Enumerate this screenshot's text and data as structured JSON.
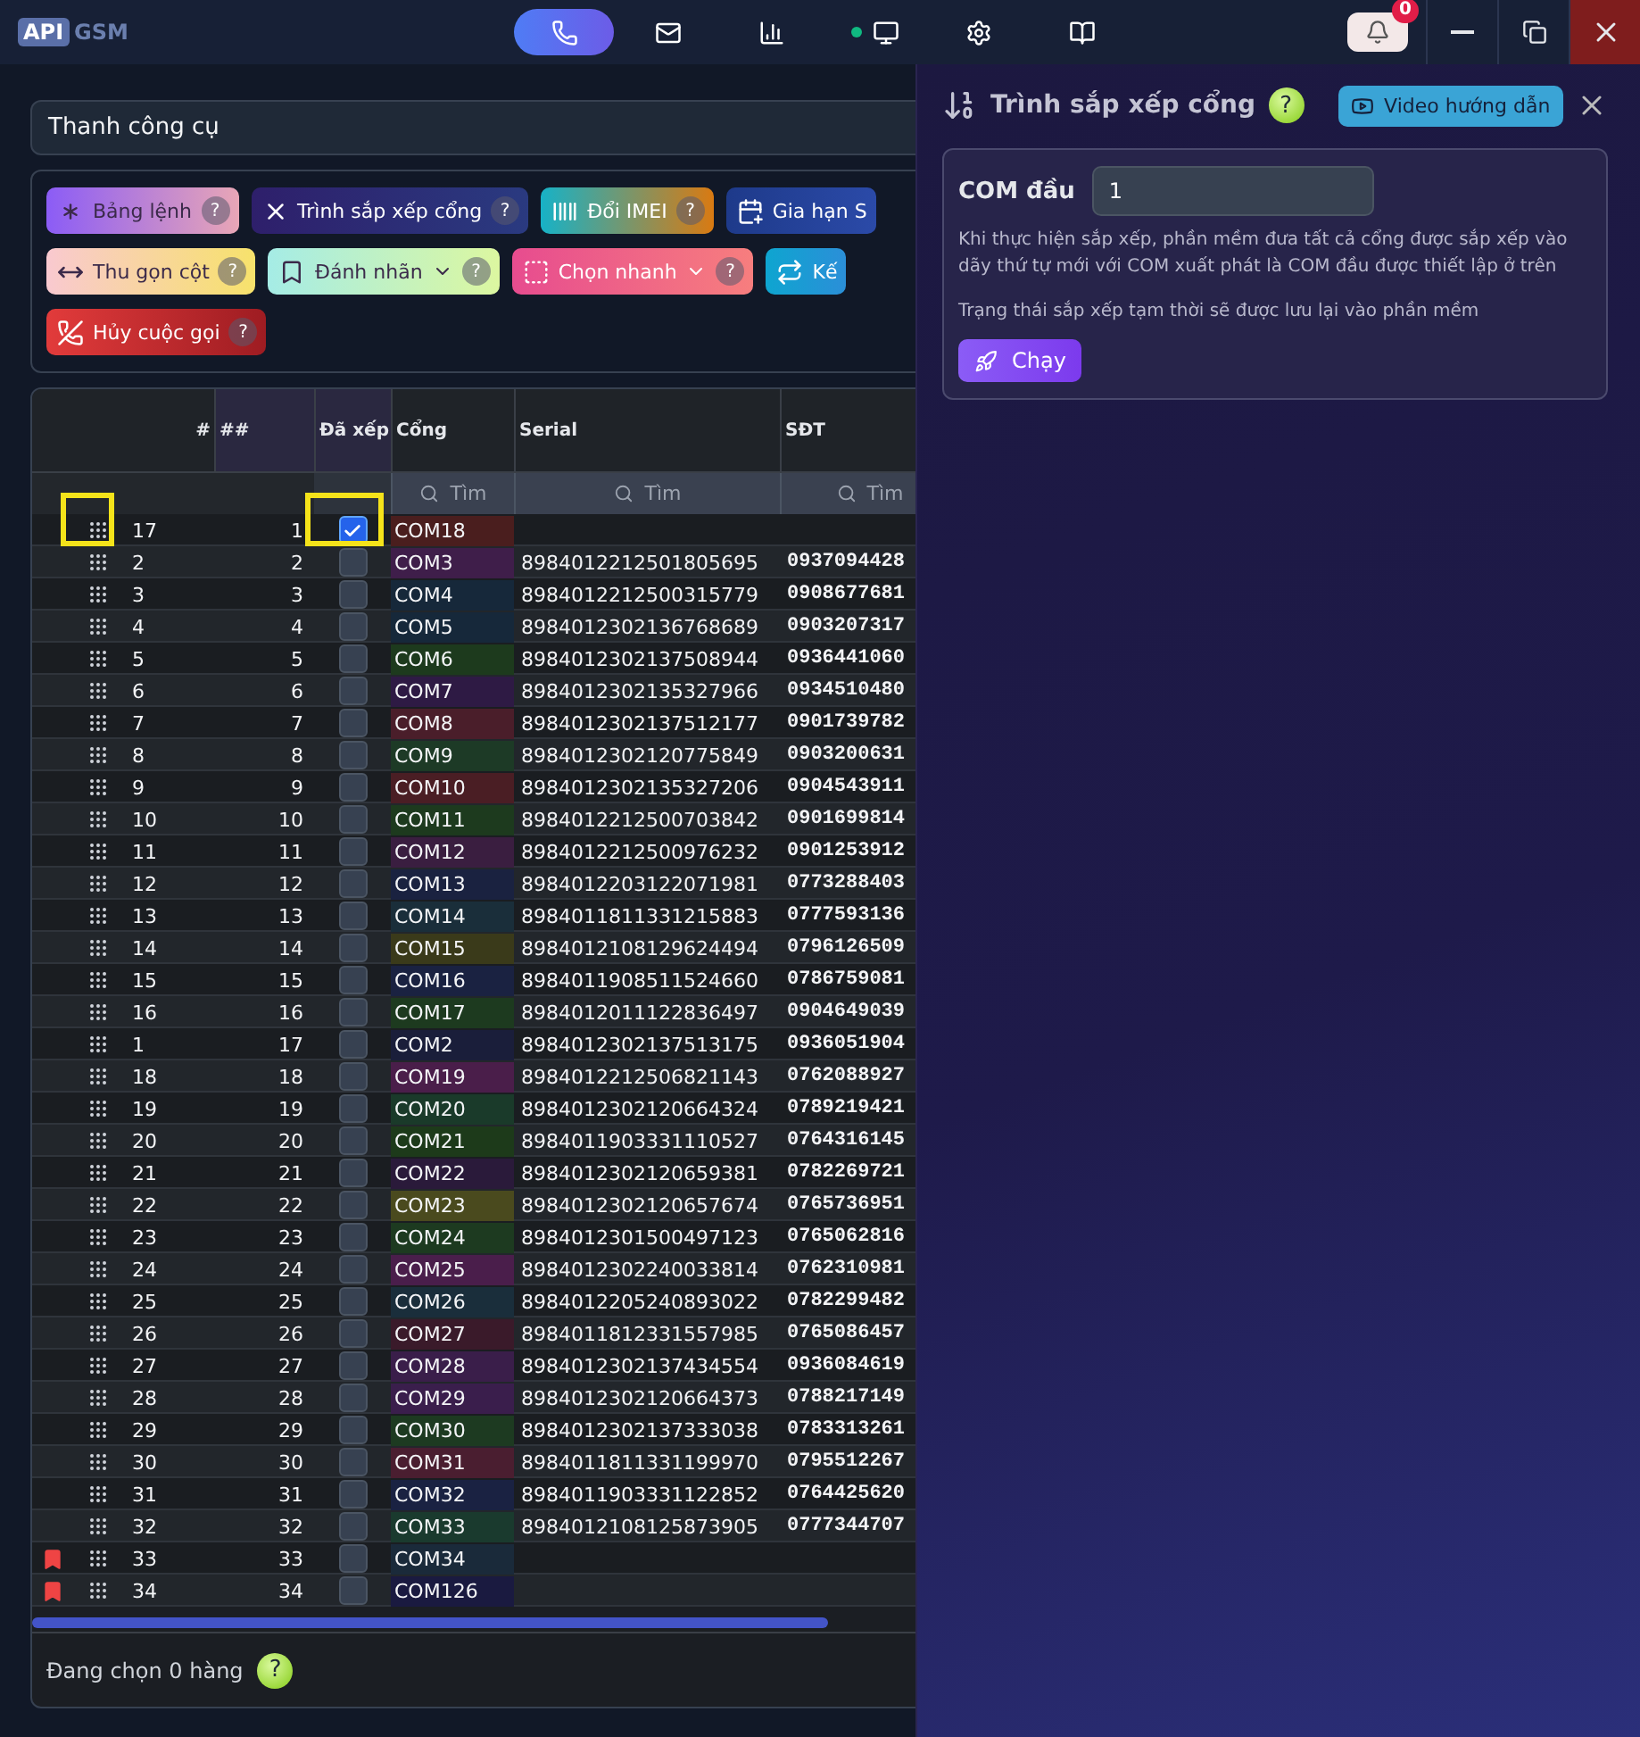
{
  "title_bar": {
    "logo": {
      "badge": "API",
      "text": "GSM"
    },
    "nav": [
      {
        "selected": true,
        "status_dot": false
      },
      {
        "selected": false,
        "status_dot": false
      },
      {
        "selected": false,
        "status_dot": false
      },
      {
        "selected": false,
        "status_dot": true
      },
      {
        "selected": false,
        "status_dot": false
      },
      {
        "selected": false,
        "status_dot": false
      }
    ],
    "notifications": {
      "count": "0"
    }
  },
  "toolbar": {
    "title": "Thanh công cụ",
    "rows": [
      [
        {
          "label": "Bảng lệnh",
          "menu": false,
          "help": "?"
        },
        {
          "label": "Trình sắp xếp cổng",
          "menu": false,
          "help": "?"
        },
        {
          "label": "Đổi IMEI",
          "menu": false,
          "help": "?"
        },
        {
          "label": "Gia hạn S",
          "menu": false
        }
      ],
      [
        {
          "label": "Thu gọn cột",
          "menu": false,
          "help": "?"
        },
        {
          "label": "Đánh nhãn",
          "menu": true,
          "help": "?"
        },
        {
          "label": "Chọn nhanh",
          "menu": true,
          "help": "?"
        },
        {
          "label": "Kế",
          "menu": false
        }
      ],
      [
        {
          "label": "Hủy cuộc gọi",
          "menu": false,
          "help": "?"
        }
      ]
    ]
  },
  "table": {
    "columns": [
      {
        "label": "#",
        "highlighted": false
      },
      {
        "label": "##",
        "highlighted": true
      },
      {
        "label": "Đã xếp",
        "highlighted": true
      },
      {
        "label": "Cổng",
        "highlighted": false
      },
      {
        "label": "Serial",
        "highlighted": false
      },
      {
        "label": "SĐT",
        "highlighted": false
      }
    ],
    "filters": [
      {
        "placeholder": "Tìm"
      },
      {
        "placeholder": "Tìm"
      },
      {
        "placeholder": "Tìm"
      }
    ],
    "rows": [
      {
        "index": "17",
        "order": "1",
        "checked": true,
        "highlighted": true,
        "flagged": false,
        "port": "COM18",
        "color": "#4a1e1e"
      },
      {
        "index": "2",
        "order": "2",
        "checked": false,
        "highlighted": false,
        "flagged": false,
        "port": "COM3",
        "color": "#3f1e4a",
        "serial": "8984012212501805695",
        "phone": "0937094428"
      },
      {
        "index": "3",
        "order": "3",
        "checked": false,
        "highlighted": false,
        "flagged": false,
        "port": "COM4",
        "color": "#16283a",
        "serial": "8984012212500315779",
        "phone": "0908677681"
      },
      {
        "index": "4",
        "order": "4",
        "checked": false,
        "highlighted": false,
        "flagged": false,
        "port": "COM5",
        "color": "#16283a",
        "serial": "8984012302136768689",
        "phone": "0903207317"
      },
      {
        "index": "5",
        "order": "5",
        "checked": false,
        "highlighted": false,
        "flagged": false,
        "port": "COM6",
        "color": "#1d3a1d",
        "serial": "8984012302137508944",
        "phone": "0936441060"
      },
      {
        "index": "6",
        "order": "6",
        "checked": false,
        "highlighted": false,
        "flagged": false,
        "port": "COM7",
        "color": "#2e1a44",
        "serial": "8984012302135327966",
        "phone": "0934510480"
      },
      {
        "index": "7",
        "order": "7",
        "checked": false,
        "highlighted": false,
        "flagged": false,
        "port": "COM8",
        "color": "#4a1e2a",
        "serial": "8984012302137512177",
        "phone": "0901739782"
      },
      {
        "index": "8",
        "order": "8",
        "checked": false,
        "highlighted": false,
        "flagged": false,
        "port": "COM9",
        "color": "#1d3a26",
        "serial": "8984012302120775849",
        "phone": "0903200631"
      },
      {
        "index": "9",
        "order": "9",
        "checked": false,
        "highlighted": false,
        "flagged": false,
        "port": "COM10",
        "color": "#4a1e24",
        "serial": "8984012302135327206",
        "phone": "0904543911"
      },
      {
        "index": "10",
        "order": "10",
        "checked": false,
        "highlighted": false,
        "flagged": false,
        "port": "COM11",
        "color": "#1d3a1e",
        "serial": "8984012212500703842",
        "phone": "0901699814"
      },
      {
        "index": "11",
        "order": "11",
        "checked": false,
        "highlighted": false,
        "flagged": false,
        "port": "COM12",
        "color": "#3a1e40",
        "serial": "8984012212500976232",
        "phone": "0901253912"
      },
      {
        "index": "12",
        "order": "12",
        "checked": false,
        "highlighted": false,
        "flagged": false,
        "port": "COM13",
        "color": "#1a2240",
        "serial": "8984012203122071981",
        "phone": "0773288403"
      },
      {
        "index": "13",
        "order": "13",
        "checked": false,
        "highlighted": false,
        "flagged": false,
        "port": "COM14",
        "color": "#1a2e3a",
        "serial": "8984011811331215883",
        "phone": "0777593136"
      },
      {
        "index": "14",
        "order": "14",
        "checked": false,
        "highlighted": false,
        "flagged": false,
        "port": "COM15",
        "color": "#3a3a1a",
        "serial": "8984012108129624494",
        "phone": "0796126509"
      },
      {
        "index": "15",
        "order": "15",
        "checked": false,
        "highlighted": false,
        "flagged": false,
        "port": "COM16",
        "color": "#1a2241",
        "serial": "8984011908511524660",
        "phone": "0786759081"
      },
      {
        "index": "16",
        "order": "16",
        "checked": false,
        "highlighted": false,
        "flagged": false,
        "port": "COM17",
        "color": "#1d3a1f",
        "serial": "8984012011122836497",
        "phone": "0904649039"
      },
      {
        "index": "1",
        "order": "17",
        "checked": false,
        "highlighted": false,
        "flagged": false,
        "port": "COM2",
        "color": "#1a1e3a",
        "serial": "8984012302137513175",
        "phone": "0936051904"
      },
      {
        "index": "18",
        "order": "18",
        "checked": false,
        "highlighted": false,
        "flagged": false,
        "port": "COM19",
        "color": "#4a1e4a",
        "serial": "8984012212506821143",
        "phone": "0762088927"
      },
      {
        "index": "19",
        "order": "19",
        "checked": false,
        "highlighted": false,
        "flagged": false,
        "port": "COM20",
        "color": "#1a3a2a",
        "serial": "8984012302120664324",
        "phone": "0789219421"
      },
      {
        "index": "20",
        "order": "20",
        "checked": false,
        "highlighted": false,
        "flagged": false,
        "port": "COM21",
        "color": "#1d3a1a",
        "serial": "8984011903331110527",
        "phone": "0764316145"
      },
      {
        "index": "21",
        "order": "21",
        "checked": false,
        "highlighted": false,
        "flagged": false,
        "port": "COM22",
        "color": "#2a1a3a",
        "serial": "8984012302120659381",
        "phone": "0782269721"
      },
      {
        "index": "22",
        "order": "22",
        "checked": false,
        "highlighted": false,
        "flagged": false,
        "port": "COM23",
        "color": "#4a4a1e",
        "serial": "8984012302120657674",
        "phone": "0765736951"
      },
      {
        "index": "23",
        "order": "23",
        "checked": false,
        "highlighted": false,
        "flagged": false,
        "port": "COM24",
        "color": "#1d3a20",
        "serial": "8984012301500497123",
        "phone": "0765062816"
      },
      {
        "index": "24",
        "order": "24",
        "checked": false,
        "highlighted": false,
        "flagged": false,
        "port": "COM25",
        "color": "#4a1e4b",
        "serial": "8984012302240033814",
        "phone": "0762310981"
      },
      {
        "index": "25",
        "order": "25",
        "checked": false,
        "highlighted": false,
        "flagged": false,
        "port": "COM26",
        "color": "#1a2e3b",
        "serial": "8984012205240893022",
        "phone": "0782299482"
      },
      {
        "index": "26",
        "order": "26",
        "checked": false,
        "highlighted": false,
        "flagged": false,
        "port": "COM27",
        "color": "#3a1a2a",
        "serial": "8984011812331557985",
        "phone": "0765086457"
      },
      {
        "index": "27",
        "order": "27",
        "checked": false,
        "highlighted": false,
        "flagged": false,
        "port": "COM28",
        "color": "#3a1e4a",
        "serial": "8984012302137434554",
        "phone": "0936084619"
      },
      {
        "index": "28",
        "order": "28",
        "checked": false,
        "highlighted": false,
        "flagged": false,
        "port": "COM29",
        "color": "#3a1e4c",
        "serial": "8984012302120664373",
        "phone": "0788217149"
      },
      {
        "index": "29",
        "order": "29",
        "checked": false,
        "highlighted": false,
        "flagged": false,
        "port": "COM30",
        "color": "#1d3a21",
        "serial": "8984012302137333038",
        "phone": "0783313261"
      },
      {
        "index": "30",
        "order": "30",
        "checked": false,
        "highlighted": false,
        "flagged": false,
        "port": "COM31",
        "color": "#4a1e30",
        "serial": "8984011811331199970",
        "phone": "0795512267"
      },
      {
        "index": "31",
        "order": "31",
        "checked": false,
        "highlighted": false,
        "flagged": false,
        "port": "COM32",
        "color": "#1a2242",
        "serial": "8984011903331122852",
        "phone": "0764425620"
      },
      {
        "index": "32",
        "order": "32",
        "checked": false,
        "highlighted": false,
        "flagged": false,
        "port": "COM33",
        "color": "#1a3a2e",
        "serial": "8984012108125873905",
        "phone": "0777344707"
      },
      {
        "index": "33",
        "order": "33",
        "checked": false,
        "highlighted": false,
        "flagged": true,
        "port": "COM34",
        "color": "#1a2a3a"
      },
      {
        "index": "34",
        "order": "34",
        "checked": false,
        "highlighted": false,
        "flagged": true,
        "port": "COM126",
        "color": "#1a1a40"
      }
    ],
    "footer": {
      "status": "Đang chọn 0 hàng",
      "help": "?"
    }
  },
  "side_panel": {
    "title": "Trình sắp xếp cổng",
    "help": "?",
    "video_button": "Video hướng dẫn",
    "field": {
      "label": "COM đầu",
      "value": "1"
    },
    "description": "Khi thực hiện sắp xếp, phần mềm đưa tất cả cổng được sắp xếp vào dãy thứ tự mới với COM xuất phát là COM đầu được thiết lập ở trên",
    "note": "Trạng thái sắp xếp tạm thời sẽ được lưu lại vào phần mềm",
    "run_button": "Chạy"
  }
}
